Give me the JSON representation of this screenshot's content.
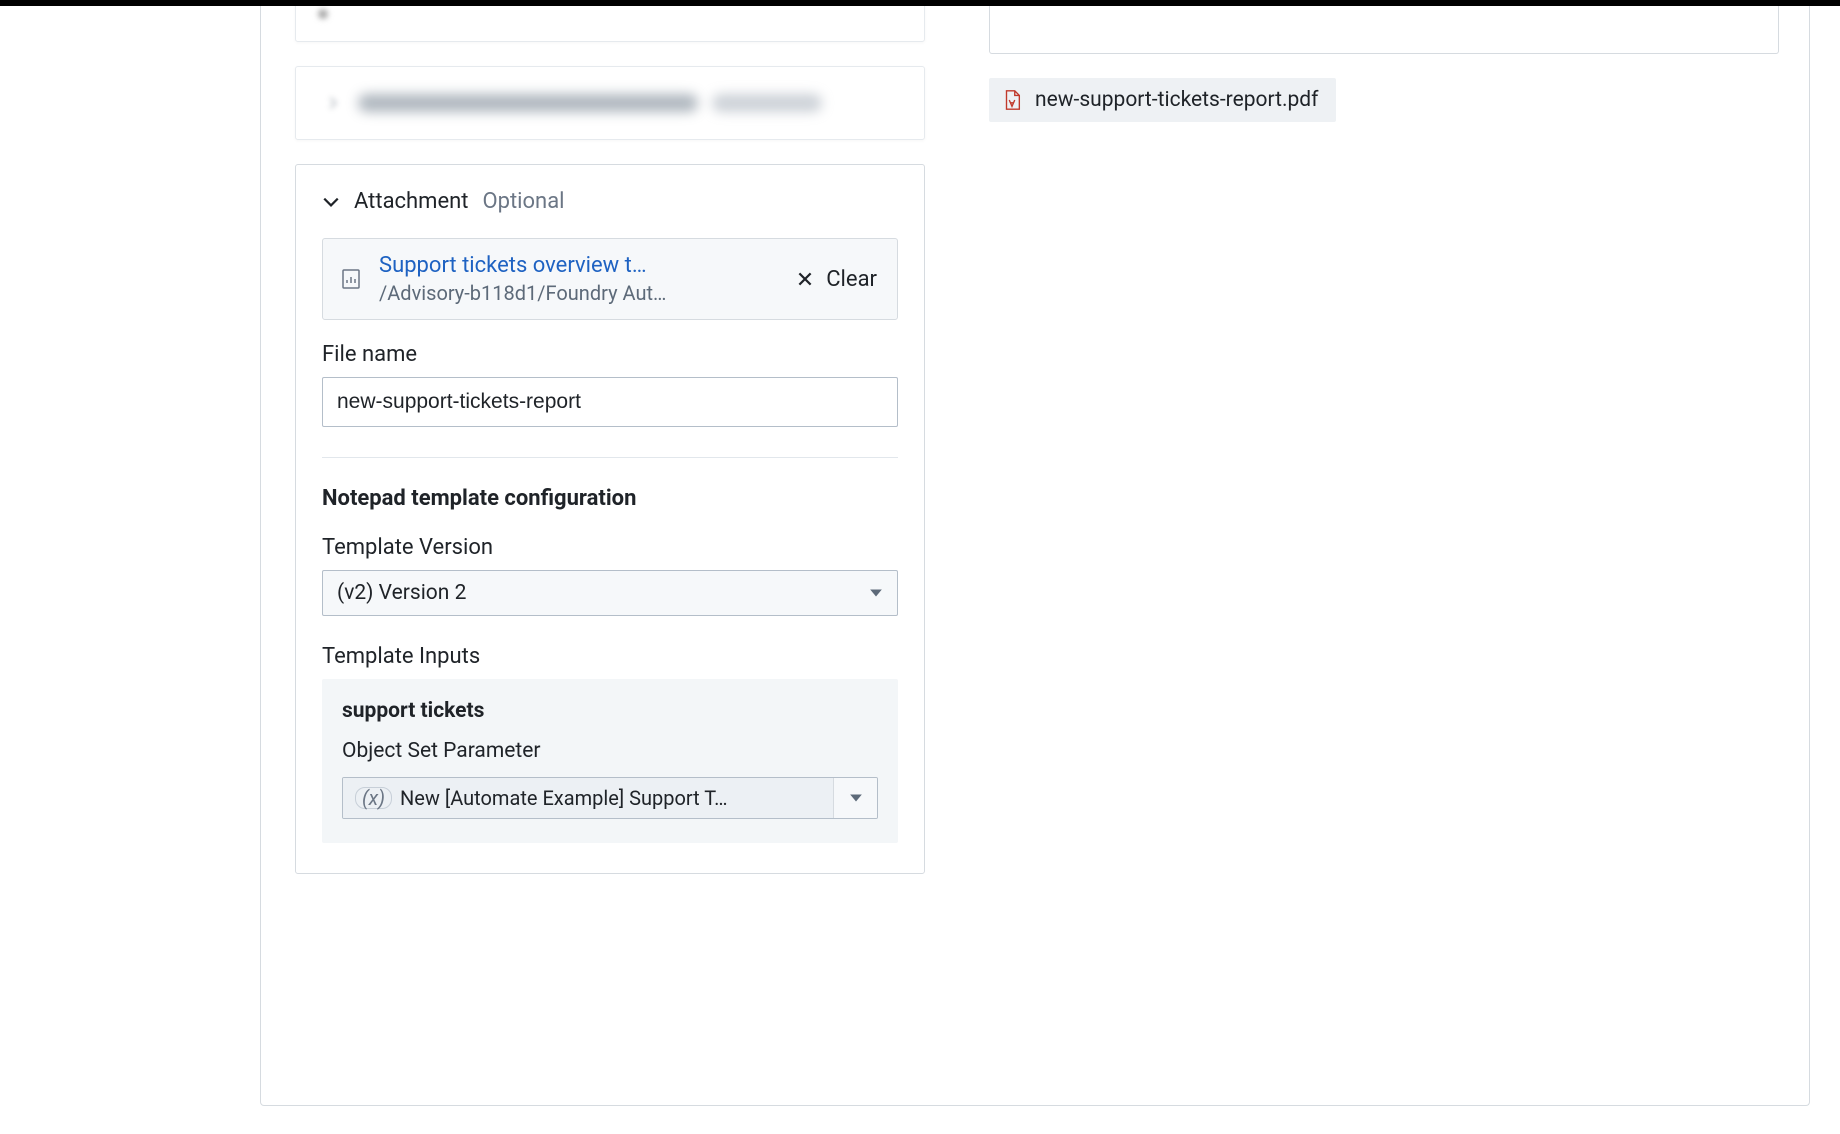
{
  "panels": {
    "attachment": {
      "title": "Attachment",
      "optional": "Optional",
      "resource": {
        "name_truncated": "Support tickets overview t…",
        "path_truncated": "/Advisory-b118d1/Foundry Aut…"
      },
      "clear": "Clear",
      "file_name_label": "File name",
      "file_name_value": "new-support-tickets-report"
    },
    "notepad": {
      "heading": "Notepad template configuration",
      "version_label": "Template Version",
      "version_value": "(v2) Version 2",
      "inputs_label": "Template Inputs",
      "inputs": {
        "group_title": "support tickets",
        "param_label": "Object Set Parameter",
        "param_badge": "(x)",
        "param_value_truncated": "New [Automate Example] Support T…"
      }
    }
  },
  "right": {
    "file_chip": "new-support-tickets-report.pdf"
  }
}
